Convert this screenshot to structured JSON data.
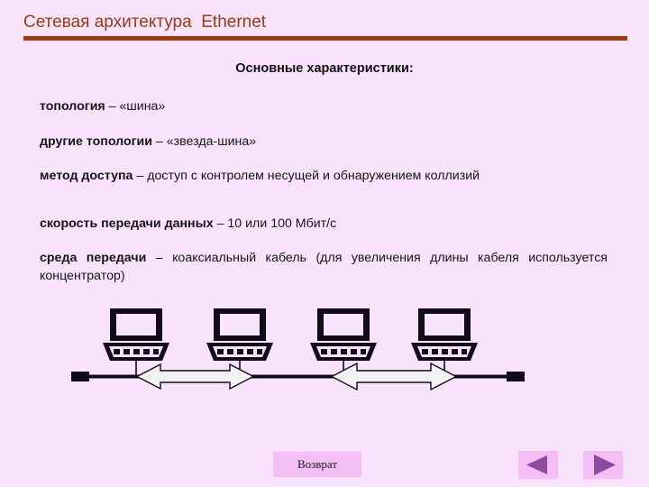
{
  "slide": {
    "title": "Сетевая архитектура  Ethernet",
    "title_color": "#9e3b10",
    "background_color": "#f9e2fb"
  },
  "content": {
    "heading": "Основные характеристики:",
    "items": [
      {
        "term": "топология",
        "dash": " – ",
        "rest": "«шина»"
      },
      {
        "term": "другие топологии",
        "dash": " – ",
        "rest": "«звезда-шина»"
      },
      {
        "term": "метод доступа",
        "dash": " – ",
        "rest": "доступ с контролем несущей и обнаружением коллизий"
      },
      {
        "term": "скорость передачи данных",
        "dash": " – ",
        "rest": "10 или 100 Мбит/с"
      },
      {
        "term": "среда передачи",
        "dash": " – ",
        "rest": "коаксиальный кабель (для увеличения длины кабеля используется концентратор)"
      }
    ]
  },
  "diagram": {
    "name": "bus-topology-diagram",
    "node_count": 4,
    "node_label": "computer",
    "bus_label": "coaxial-bus-cable",
    "terminator_label": "bus-terminator",
    "arrow_label": "data-flow-arrow",
    "arrow_count": 2,
    "line_color": "#120a18",
    "arrow_fill": "#f2f2f2"
  },
  "footer": {
    "return_label": "Возврат",
    "prev_label": "◀",
    "next_label": "▶",
    "button_color": "#f3bdf6",
    "arrow_color": "#8e4a9e"
  }
}
